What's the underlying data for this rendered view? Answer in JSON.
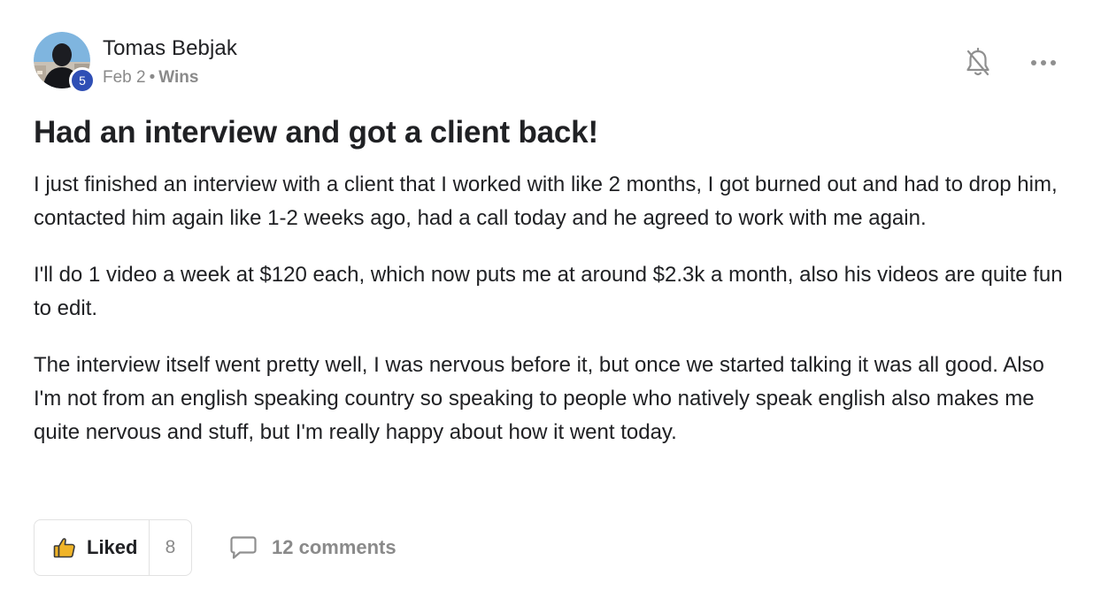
{
  "post": {
    "author": {
      "name": "Tomas Bebjak",
      "level": "5",
      "avatar_icon": "user-avatar-photo"
    },
    "meta": {
      "date": "Feb 2",
      "separator": "•",
      "category": "Wins"
    },
    "title": "Had an interview and got a client back!",
    "paragraphs": [
      "I just finished an interview with a client that I worked with like 2 months, I got burned out and had to drop him, contacted him again like 1-2 weeks ago, had a call today and he agreed to work with me again.",
      "I'll do 1 video a week at $120 each, which now puts me at around $2.3k a month, also his videos are quite fun to edit.",
      "The interview itself went pretty well, I was nervous before it, but once we started talking it was all good. Also I'm not from an english speaking country so speaking to people who natively speak english also makes me quite nervous and stuff, but I'm really happy about how it went today."
    ],
    "actions": {
      "like_label": "Liked",
      "like_count": "8",
      "comments_label": "12 comments"
    },
    "icons": {
      "bell": "bell-off-icon",
      "more": "more-horizontal-icon",
      "like": "thumbs-up-icon",
      "comment": "comment-icon"
    },
    "colors": {
      "badge": "#2f4fb5",
      "like_icon": "#f0b428",
      "muted_text": "#8a8a8a"
    }
  }
}
